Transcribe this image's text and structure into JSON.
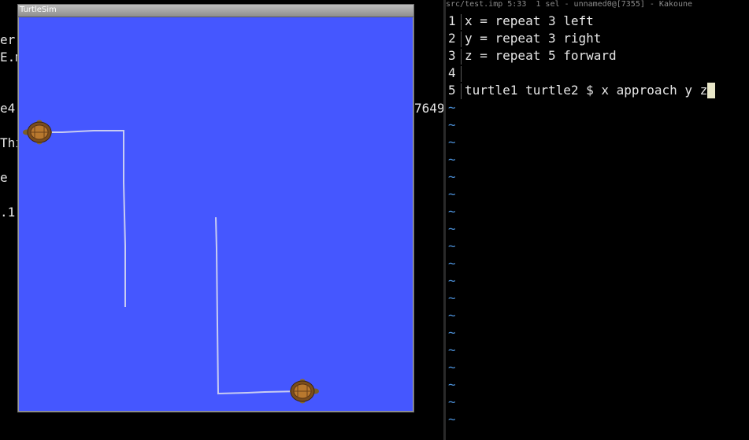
{
  "colors": {
    "canvas_bg": "#4557ff",
    "path_color": "#c8ccf2",
    "tilde_color": "#4b8fd6",
    "cursor_color": "#e8e6c8"
  },
  "left_terminal": {
    "fragments": [
      "er",
      "E.m",
      "e4",
      "7649",
      "Thi",
      "e ",
      ".1"
    ]
  },
  "turtlesim": {
    "title": "TurtleSim",
    "turtles": [
      {
        "name": "turtle1",
        "icon": "turtle-icon"
      },
      {
        "name": "turtle2",
        "icon": "turtle-icon"
      }
    ]
  },
  "editor": {
    "status": "src/test.imp 5:33  1 sel - unnamed0@[7355] - Kakoune",
    "lines": [
      {
        "num": "1",
        "text": "x = repeat 3 left"
      },
      {
        "num": "2",
        "text": "y = repeat 3 right"
      },
      {
        "num": "3",
        "text": "z = repeat 5 forward"
      },
      {
        "num": "4",
        "text": ""
      },
      {
        "num": "5",
        "text": "turtle1 turtle2 $ x approach y z"
      }
    ],
    "tilde": "~"
  }
}
